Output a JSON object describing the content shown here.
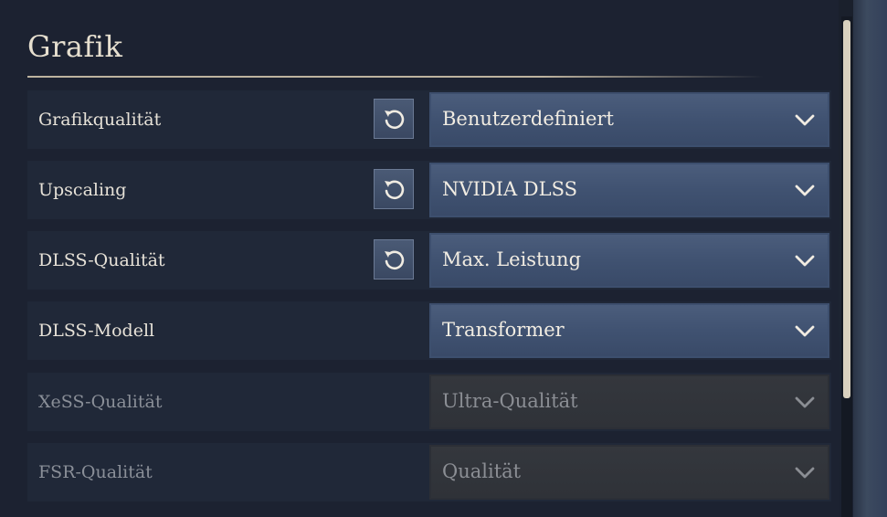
{
  "section": {
    "title": "Grafik"
  },
  "settings": [
    {
      "label": "Grafikqualität",
      "value": "Benutzerdefiniert",
      "has_reset": true,
      "enabled": true
    },
    {
      "label": "Upscaling",
      "value": "NVIDIA DLSS",
      "has_reset": true,
      "enabled": true
    },
    {
      "label": "DLSS-Qualität",
      "value": "Max. Leistung",
      "has_reset": true,
      "enabled": true
    },
    {
      "label": "DLSS-Modell",
      "value": "Transformer",
      "has_reset": false,
      "enabled": true
    },
    {
      "label": "XeSS-Qualität",
      "value": "Ultra-Qualität",
      "has_reset": false,
      "enabled": false
    },
    {
      "label": "FSR-Qualität",
      "value": "Qualität",
      "has_reset": false,
      "enabled": false
    }
  ],
  "icons": {
    "reset": "reset-icon",
    "dropdown": "chevron-down-icon"
  },
  "colors": {
    "accent": "#4b5d7c",
    "text": "#e7e2d8",
    "disabled_text": "#8a8f98",
    "panel": "#1c2231"
  }
}
